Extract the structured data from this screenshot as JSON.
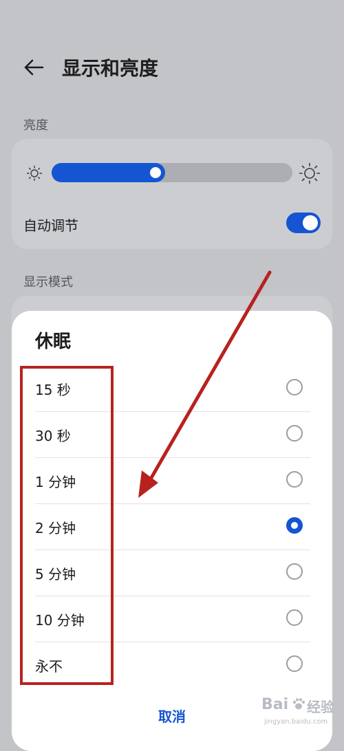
{
  "header": {
    "title": "显示和亮度",
    "back_icon": "back-arrow-icon"
  },
  "brightness": {
    "section_label": "亮度",
    "slider_level_percent": 47,
    "auto_adjust_label": "自动调节",
    "auto_adjust_on": true
  },
  "display_mode": {
    "section_label": "显示模式"
  },
  "sleep_dialog": {
    "title": "休眠",
    "options": [
      {
        "label": "15 秒",
        "selected": false
      },
      {
        "label": "30 秒",
        "selected": false
      },
      {
        "label": "1 分钟",
        "selected": false
      },
      {
        "label": "2 分钟",
        "selected": true
      },
      {
        "label": "5 分钟",
        "selected": false
      },
      {
        "label": "10 分钟",
        "selected": false
      },
      {
        "label": "永不",
        "selected": false
      }
    ],
    "cancel_label": "取消"
  },
  "colors": {
    "accent": "#1555d2",
    "annotation": "#b7221f",
    "background": "#c3c4c8"
  },
  "watermark": {
    "logo_text": "Bai",
    "logo_suffix": "经验",
    "url": "jingyan.baidu.com"
  }
}
